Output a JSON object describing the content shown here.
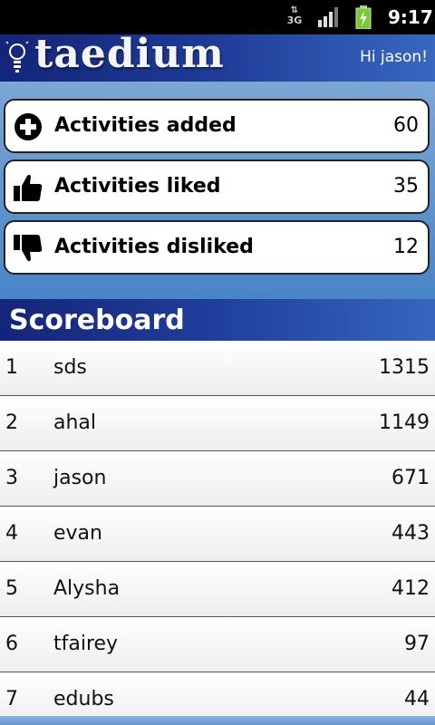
{
  "status_bar": {
    "network": "3G",
    "time": "9:17",
    "icons": [
      "data-arrows-icon",
      "signal-icon",
      "battery-charging-icon"
    ]
  },
  "header": {
    "app_name": "taedium",
    "greeting": "Hi jason!",
    "logo_icon": "lightbulb-icon"
  },
  "stats": [
    {
      "label": "Activities added",
      "count": "60",
      "icon": "plus-circle-icon"
    },
    {
      "label": "Activities liked",
      "count": "35",
      "icon": "thumbs-up-icon"
    },
    {
      "label": "Activities disliked",
      "count": "12",
      "icon": "thumbs-down-icon"
    }
  ],
  "scoreboard": {
    "title": "Scoreboard",
    "rows": [
      {
        "rank": "1",
        "name": "sds",
        "score": "1315"
      },
      {
        "rank": "2",
        "name": "ahal",
        "score": "1149"
      },
      {
        "rank": "3",
        "name": "jason",
        "score": "671"
      },
      {
        "rank": "4",
        "name": "evan",
        "score": "443"
      },
      {
        "rank": "5",
        "name": "Alysha",
        "score": "412"
      },
      {
        "rank": "6",
        "name": "tfairey",
        "score": "97"
      },
      {
        "rank": "7",
        "name": "edubs",
        "score": "44"
      }
    ]
  },
  "colors": {
    "header_dark": "#132579",
    "header_light": "#3768c0",
    "background": "#4a86c8"
  }
}
